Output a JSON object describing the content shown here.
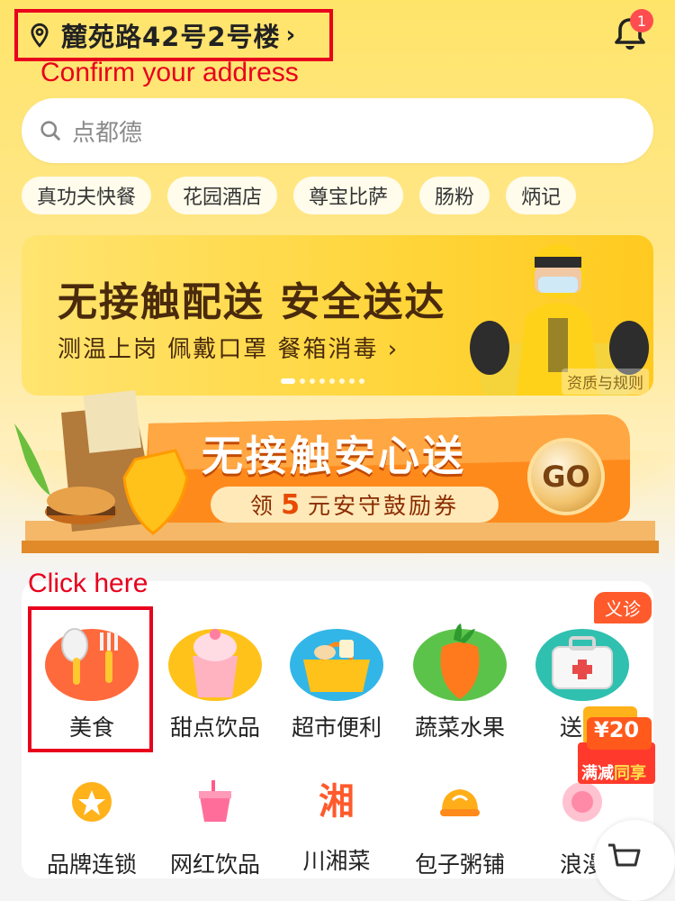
{
  "header": {
    "address": "麓苑路42号2号楼",
    "chevron": "›",
    "annotation": "Confirm your address",
    "notification_count": "1"
  },
  "search": {
    "placeholder": "点都德"
  },
  "hot_tags": [
    "真功夫快餐",
    "花园酒店",
    "尊宝比萨",
    "肠粉",
    "炳记"
  ],
  "banner": {
    "title": "无接触配送 安全送达",
    "subtitle": "测温上岗 佩戴口罩 餐箱消毒 ›",
    "qualification_link": "资质与规则",
    "page_count": 8,
    "active_page": 1
  },
  "promo": {
    "title": "无接触安心送",
    "subtitle_prefix": "领",
    "subtitle_amount": "5",
    "subtitle_suffix": "元安守鼓励券",
    "go_label": "GO"
  },
  "categories": {
    "annotation": "Click here",
    "row1": [
      "美食",
      "甜点饮品",
      "超市便利",
      "蔬菜水果",
      "送药"
    ],
    "row2": [
      "品牌连锁",
      "网红饮品",
      "川湘菜",
      "包子粥铺",
      "浪漫"
    ],
    "yizhen_badge": "义诊",
    "xiang_glyph": "湘"
  },
  "floating_coupon": {
    "amount": "¥20",
    "label_a": "满减",
    "label_b": "同享"
  },
  "colors": {
    "annotation_red": "#e8001c",
    "theme_yellow": "#ffe46a",
    "promo_orange": "#ff8a1c"
  }
}
